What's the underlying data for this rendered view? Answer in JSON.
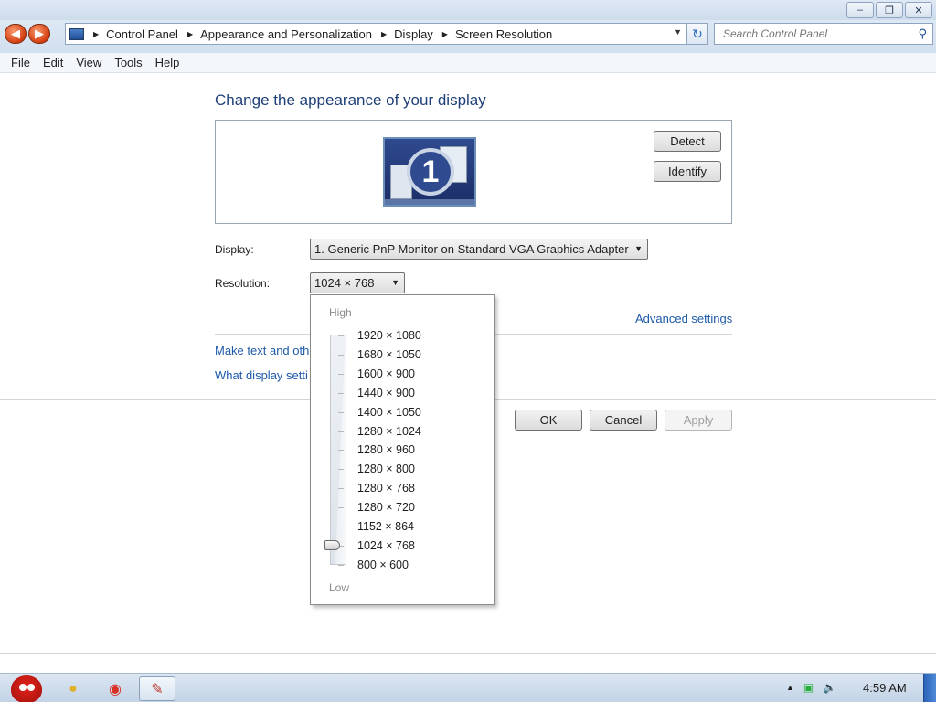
{
  "window": {
    "minimize_icon": "minimize-icon",
    "restore_icon": "restore-icon",
    "close_icon": "close-icon"
  },
  "address": {
    "crumbs": [
      "Control Panel",
      "Appearance and Personalization",
      "Display",
      "Screen Resolution"
    ],
    "search_placeholder": "Search Control Panel"
  },
  "menu": [
    "File",
    "Edit",
    "View",
    "Tools",
    "Help"
  ],
  "page": {
    "title": "Change the appearance of your display",
    "monitor_number": "1",
    "detect_label": "Detect",
    "identify_label": "Identify",
    "display_label": "Display:",
    "display_value": "1. Generic PnP Monitor on Standard VGA Graphics Adapter",
    "resolution_label": "Resolution:",
    "resolution_value": "1024 × 768",
    "advanced_link": "Advanced settings",
    "make_text_link": "Make text and oth",
    "what_display_link": "What display setti",
    "ok_label": "OK",
    "cancel_label": "Cancel",
    "apply_label": "Apply"
  },
  "dropdown": {
    "high_label": "High",
    "low_label": "Low",
    "options": [
      "1920 × 1080",
      "1680 × 1050",
      "1600 × 900",
      "1440 × 900",
      "1400 × 1050",
      "1280 × 1024",
      "1280 × 960",
      "1280 × 800",
      "1280 × 768",
      "1280 × 720",
      "1152 × 864",
      "1024 × 768",
      "800 × 600"
    ],
    "selected": "1024 × 768"
  },
  "taskbar": {
    "clock": "4:59 AM"
  }
}
